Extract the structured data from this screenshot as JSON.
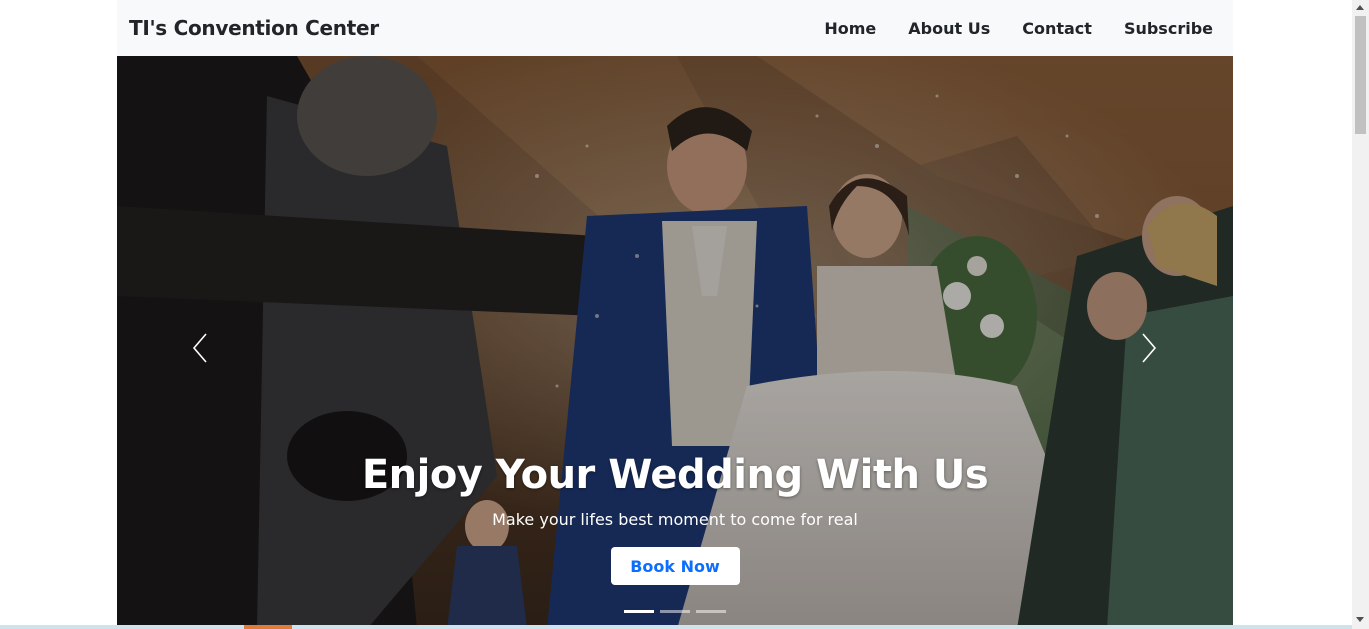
{
  "navbar": {
    "brand": "TI's Convention Center",
    "links": [
      "Home",
      "About Us",
      "Contact",
      "Subscribe"
    ]
  },
  "hero": {
    "title": "Enjoy Your Wedding With Us",
    "subtitle": "Make your lifes best moment to come for real",
    "cta_label": "Book Now",
    "slide_count": 3,
    "active_slide": 1
  },
  "icons": {
    "prev": "chevron-left-icon",
    "next": "chevron-right-icon"
  },
  "colors": {
    "navbar_bg": "#f8f9fa",
    "cta_text": "#0d6efd",
    "caption_text": "#ffffff"
  }
}
